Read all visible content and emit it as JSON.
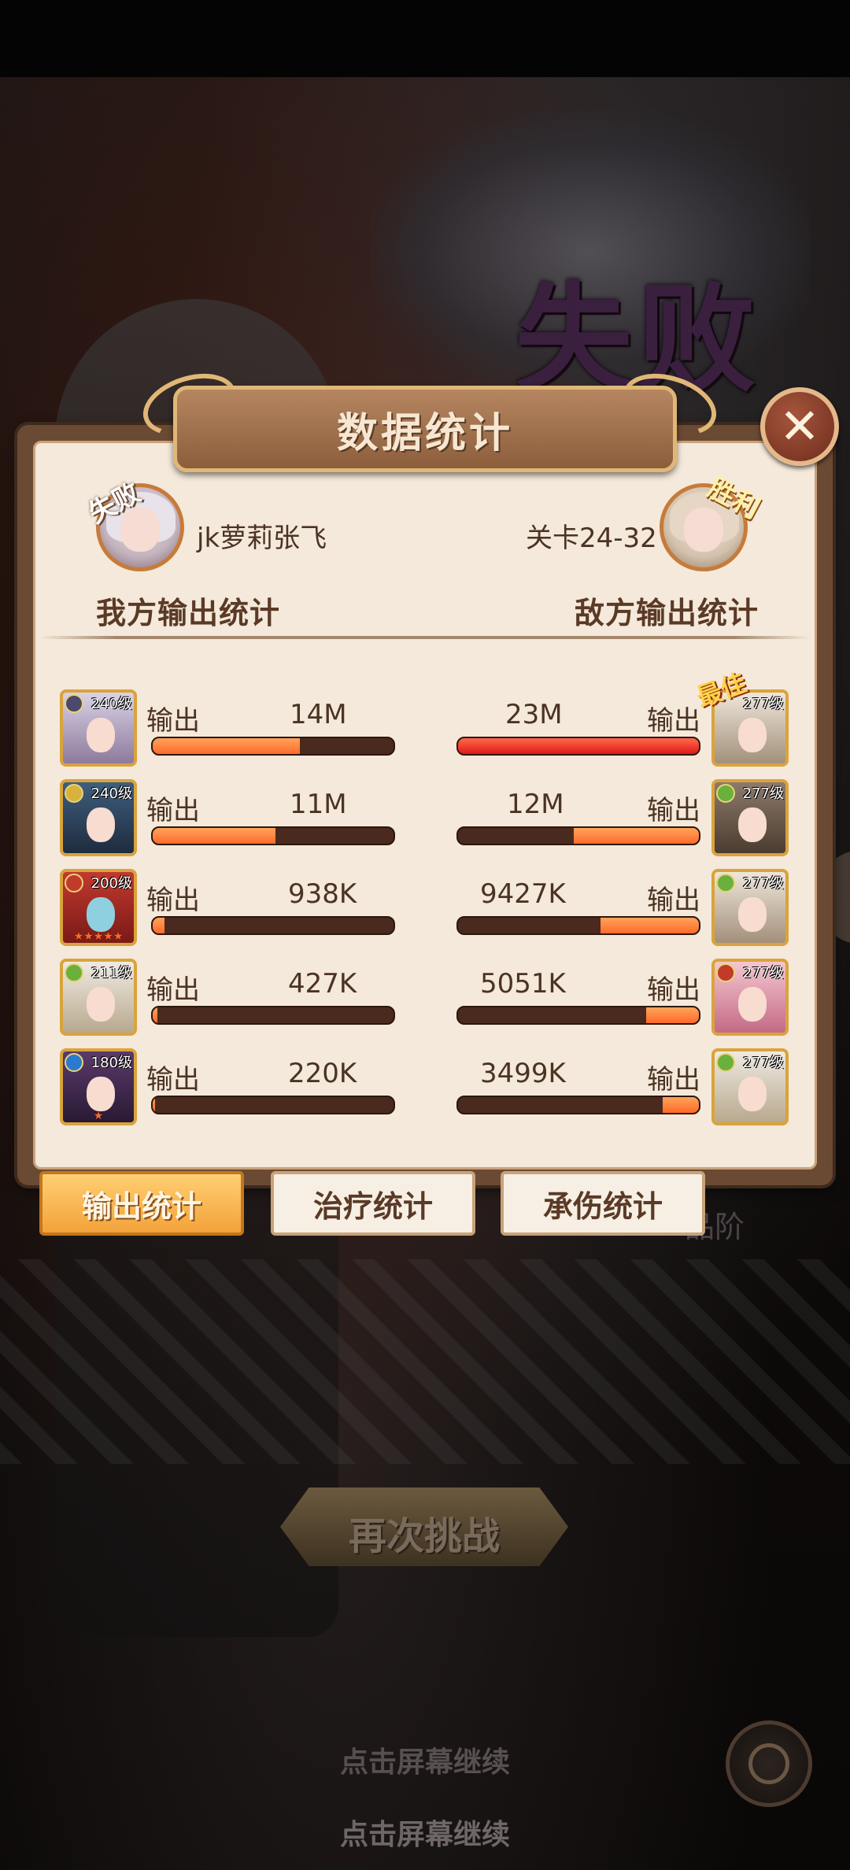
{
  "scene": {
    "defeat_title": "失败",
    "bg_side_text": "品阶"
  },
  "panel": {
    "title": "数据统计",
    "close_glyph": "✕",
    "player": {
      "name": "jk萝莉张飞",
      "stamp": "失败"
    },
    "enemy": {
      "name": "关卡24-32",
      "stamp": "胜利"
    },
    "left_section": "我方输出统计",
    "right_section": "敌方输出统计",
    "best_badge": "最佳",
    "output_label": "输出",
    "rows": [
      {
        "left": {
          "level": "240级",
          "value": "14M",
          "fill": 0.61
        },
        "right": {
          "level": "277级",
          "value": "23M",
          "fill": 1.0
        }
      },
      {
        "left": {
          "level": "240级",
          "value": "11M",
          "fill": 0.51
        },
        "right": {
          "level": "277级",
          "value": "12M",
          "fill": 0.52
        }
      },
      {
        "left": {
          "level": "200级",
          "value": "938K",
          "fill": 0.05
        },
        "right": {
          "level": "277级",
          "value": "9427K",
          "fill": 0.41
        }
      },
      {
        "left": {
          "level": "211级",
          "value": "427K",
          "fill": 0.02
        },
        "right": {
          "level": "277级",
          "value": "5051K",
          "fill": 0.22
        }
      },
      {
        "left": {
          "level": "180级",
          "value": "220K",
          "fill": 0.01
        },
        "right": {
          "level": "277级",
          "value": "3499K",
          "fill": 0.15
        }
      }
    ]
  },
  "tabs": {
    "output": "输出统计",
    "healing": "治疗统计",
    "damage_taken": "承伤统计"
  },
  "retry_button": "再次挑战",
  "continue_text_1": "点击屏幕继续",
  "continue_text_2": "点击屏幕继续",
  "colors": {
    "accent": "#ff6a2a",
    "panel_bg": "#f4e9da",
    "frame": "#6b4a33"
  }
}
